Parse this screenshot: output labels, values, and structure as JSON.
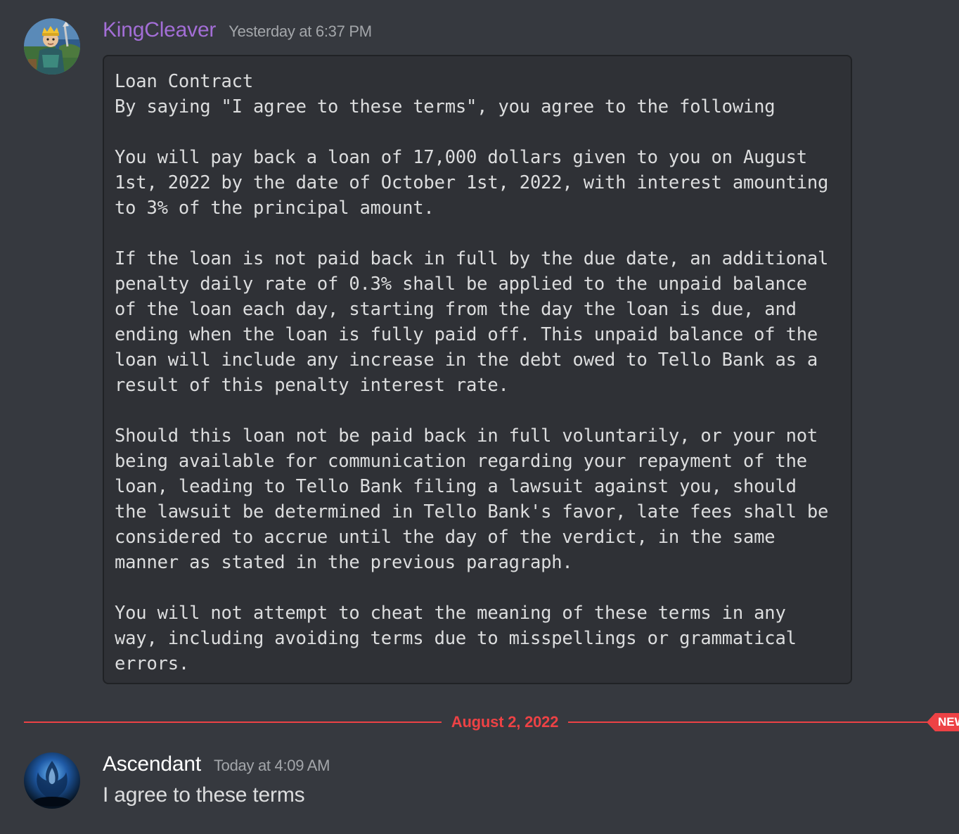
{
  "messages": [
    {
      "username": "KingCleaver",
      "username_color": "#a36ed6",
      "timestamp": "Yesterday at 6:37 PM",
      "avatar_icon": "knight-character-avatar",
      "code_block": "Loan Contract\nBy saying \"I agree to these terms\", you agree to the following\n\nYou will pay back a loan of 17,000 dollars given to you on August\n1st, 2022 by the date of October 1st, 2022, with interest amounting\nto 3% of the principal amount.\n\nIf the loan is not paid back in full by the due date, an additional\npenalty daily rate of 0.3% shall be applied to the unpaid balance\nof the loan each day, starting from the day the loan is due, and\nending when the loan is fully paid off. This unpaid balance of the\nloan will include any increase in the debt owed to Tello Bank as a\nresult of this penalty interest rate.\n\nShould this loan not be paid back in full voluntarily, or your not\nbeing available for communication regarding your repayment of the\nloan, leading to Tello Bank filing a lawsuit against you, should\nthe lawsuit be determined in Tello Bank's favor, late fees shall be\nconsidered to accrue until the day of the verdict, in the same\nmanner as stated in the previous paragraph.\n\nYou will not attempt to cheat the meaning of these terms in any\nway, including avoiding terms due to misspellings or grammatical\nerrors."
    },
    {
      "username": "Ascendant",
      "username_color": "#ffffff",
      "timestamp": "Today at 4:09 AM",
      "avatar_icon": "blue-flame-emblem-avatar",
      "text": "I agree to these terms"
    }
  ],
  "date_divider": {
    "label": "August 2, 2022",
    "color": "#ed4245",
    "new_badge": "NEW"
  },
  "theme": {
    "background": "#36393f",
    "codeblock_bg": "#2f3136",
    "text": "#dcddde",
    "timestamp": "#a3a6aa"
  }
}
